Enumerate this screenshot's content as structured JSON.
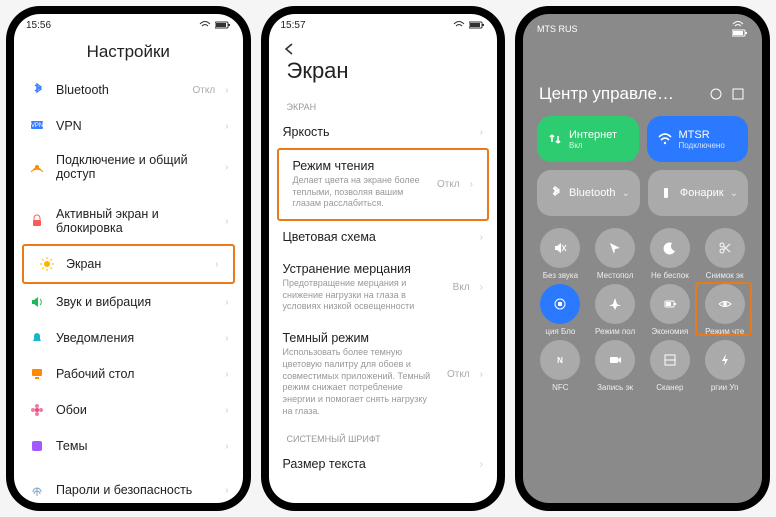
{
  "phone1": {
    "time": "15:56",
    "title": "Настройки",
    "items": [
      {
        "icon": "bluetooth",
        "color": "#3a7cff",
        "label": "Bluetooth",
        "value": "Откл"
      },
      {
        "icon": "vpn",
        "color": "#3a7cff",
        "label": "VPN",
        "value": ""
      },
      {
        "icon": "hotspot",
        "color": "#ff8a00",
        "label": "Подключение и общий доступ",
        "value": ""
      },
      {
        "spacer": true
      },
      {
        "icon": "lock",
        "color": "#ff5a5a",
        "label": "Активный экран и блокировка",
        "value": ""
      },
      {
        "icon": "sun",
        "color": "#ffb300",
        "label": "Экран",
        "value": "",
        "highlight": true
      },
      {
        "icon": "sound",
        "color": "#1db954",
        "label": "Звук и вибрация",
        "value": ""
      },
      {
        "icon": "bell",
        "color": "#15b7d0",
        "label": "Уведомления",
        "value": ""
      },
      {
        "icon": "desktop",
        "color": "#ff8a00",
        "label": "Рабочий стол",
        "value": ""
      },
      {
        "icon": "flower",
        "color": "#e64a7a",
        "label": "Обои",
        "value": ""
      },
      {
        "icon": "themes",
        "color": "#a259ff",
        "label": "Темы",
        "value": ""
      },
      {
        "spacer": true
      },
      {
        "icon": "fingerprint",
        "color": "#7aa0c4",
        "label": "Пароли и безопасность",
        "value": ""
      }
    ]
  },
  "phone2": {
    "time": "15:57",
    "title": "Экран",
    "section1": "ЭКРАН",
    "section2": "СИСТЕМНЫЙ ШРИФТ",
    "items": [
      {
        "label": "Яркость",
        "sub": "",
        "value": ""
      },
      {
        "label": "Режим чтения",
        "sub": "Делает цвета на экране более теплыми, позволяя вашим глазам расслабиться.",
        "value": "Откл",
        "highlight": true
      },
      {
        "label": "Цветовая схема",
        "sub": "",
        "value": ""
      },
      {
        "label": "Устранение мерцания",
        "sub": "Предотвращение мерцания и снижение нагрузки на глаза в условиях низкой освещенности",
        "value": "Вкл"
      },
      {
        "label": "Темный режим",
        "sub": "Использовать более темную цветовую палитру для обоев и совместимых приложений. Темный режим снижает потребление энергии и помогает снять нагрузку на глаза.",
        "value": "Откл"
      }
    ],
    "fontItem": {
      "label": "Размер текста",
      "value": ""
    }
  },
  "phone3": {
    "carrier": "MTS RUS",
    "title": "Центр управле…",
    "tiles": [
      {
        "icon": "swap",
        "bg": "#2ecc71",
        "label": "Интернет",
        "sub": "Вкл"
      },
      {
        "icon": "wifi",
        "bg": "#2b79ff",
        "label": "MTSR",
        "sub": "Подключено"
      }
    ],
    "wideButtons": [
      {
        "icon": "bluetooth",
        "label": "Bluetooth"
      },
      {
        "icon": "flashlight",
        "label": "Фонарик"
      }
    ],
    "grid": [
      {
        "icon": "mute",
        "label": "Без звука"
      },
      {
        "icon": "location",
        "label": "Местопол"
      },
      {
        "icon": "moon",
        "label": "Не беспок"
      },
      {
        "icon": "scissors",
        "label": "Снимок эк"
      },
      {
        "icon": "lock-rot",
        "label": "ция   Бло",
        "on": true
      },
      {
        "icon": "plane",
        "label": "Режим пол"
      },
      {
        "icon": "battery",
        "label": "Экономия"
      },
      {
        "icon": "eye",
        "label": "Режим чте",
        "highlight": true
      },
      {
        "icon": "nfc",
        "label": "NFC"
      },
      {
        "icon": "record",
        "label": "Запись эк"
      },
      {
        "icon": "scan",
        "label": "Сканер"
      },
      {
        "icon": "bolt",
        "label": "ргии    Уп"
      }
    ]
  }
}
